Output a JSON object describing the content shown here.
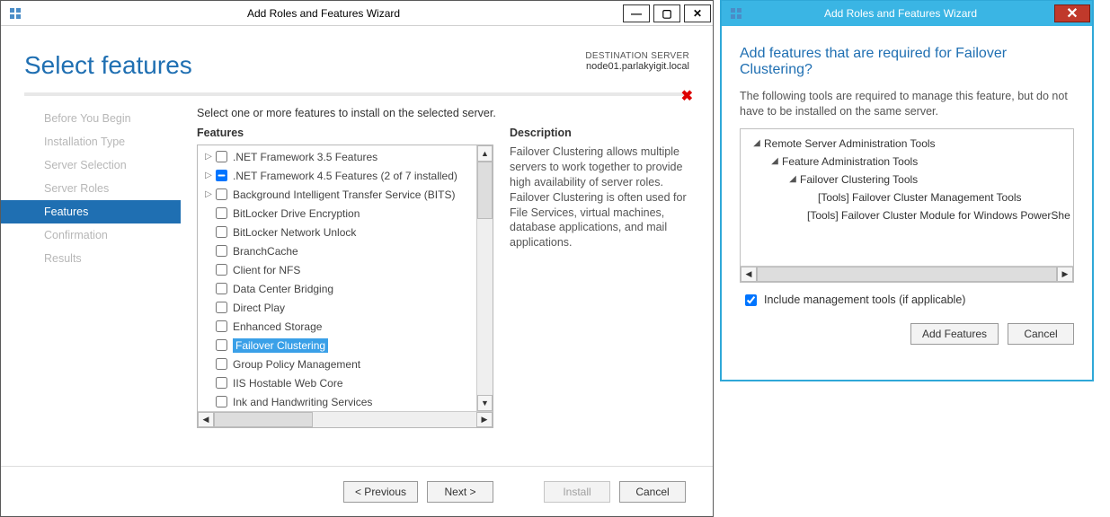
{
  "main": {
    "title": "Add Roles and Features Wizard",
    "page_heading": "Select features",
    "destination": {
      "label": "DESTINATION SERVER",
      "value": "node01.parlakyigit.local"
    },
    "instruction": "Select one or more features to install on the selected server.",
    "features_hd": "Features",
    "description_hd": "Description",
    "description_body": "Failover Clustering allows multiple servers to work together to provide high availability of server roles. Failover Clustering is often used for File Services, virtual machines, database applications, and mail applications.",
    "nav": [
      {
        "label": "Before You Begin",
        "active": false
      },
      {
        "label": "Installation Type",
        "active": false
      },
      {
        "label": "Server Selection",
        "active": false
      },
      {
        "label": "Server Roles",
        "active": false
      },
      {
        "label": "Features",
        "active": true
      },
      {
        "label": "Confirmation",
        "active": false
      },
      {
        "label": "Results",
        "active": false
      }
    ],
    "features": [
      {
        "label": ".NET Framework 3.5 Features",
        "expandable": true,
        "state": "unchecked"
      },
      {
        "label": ".NET Framework 4.5 Features (2 of 7 installed)",
        "expandable": true,
        "state": "indeterminate"
      },
      {
        "label": "Background Intelligent Transfer Service (BITS)",
        "expandable": true,
        "state": "unchecked"
      },
      {
        "label": "BitLocker Drive Encryption",
        "expandable": false,
        "state": "unchecked"
      },
      {
        "label": "BitLocker Network Unlock",
        "expandable": false,
        "state": "unchecked"
      },
      {
        "label": "BranchCache",
        "expandable": false,
        "state": "unchecked"
      },
      {
        "label": "Client for NFS",
        "expandable": false,
        "state": "unchecked"
      },
      {
        "label": "Data Center Bridging",
        "expandable": false,
        "state": "unchecked"
      },
      {
        "label": "Direct Play",
        "expandable": false,
        "state": "unchecked"
      },
      {
        "label": "Enhanced Storage",
        "expandable": false,
        "state": "unchecked"
      },
      {
        "label": "Failover Clustering",
        "expandable": false,
        "state": "unchecked",
        "selected": true
      },
      {
        "label": "Group Policy Management",
        "expandable": false,
        "state": "unchecked"
      },
      {
        "label": "IIS Hostable Web Core",
        "expandable": false,
        "state": "unchecked"
      },
      {
        "label": "Ink and Handwriting Services",
        "expandable": false,
        "state": "unchecked"
      }
    ],
    "buttons": {
      "previous": "< Previous",
      "next": "Next >",
      "install": "Install",
      "cancel": "Cancel"
    }
  },
  "dialog": {
    "title": "Add Roles and Features Wizard",
    "heading": "Add features that are required for Failover Clustering?",
    "message": "The following tools are required to manage this feature, but do not have to be installed on the same server.",
    "tree": [
      {
        "depth": 0,
        "caret": true,
        "label": "Remote Server Administration Tools"
      },
      {
        "depth": 1,
        "caret": true,
        "label": "Feature Administration Tools"
      },
      {
        "depth": 2,
        "caret": true,
        "label": "Failover Clustering Tools"
      },
      {
        "depth": 3,
        "caret": false,
        "label": "[Tools] Failover Cluster Management Tools"
      },
      {
        "depth": 3,
        "caret": false,
        "label": "[Tools] Failover Cluster Module for Windows PowerShe"
      }
    ],
    "include_label": "Include management tools (if applicable)",
    "include_checked": true,
    "buttons": {
      "add": "Add Features",
      "cancel": "Cancel"
    }
  }
}
